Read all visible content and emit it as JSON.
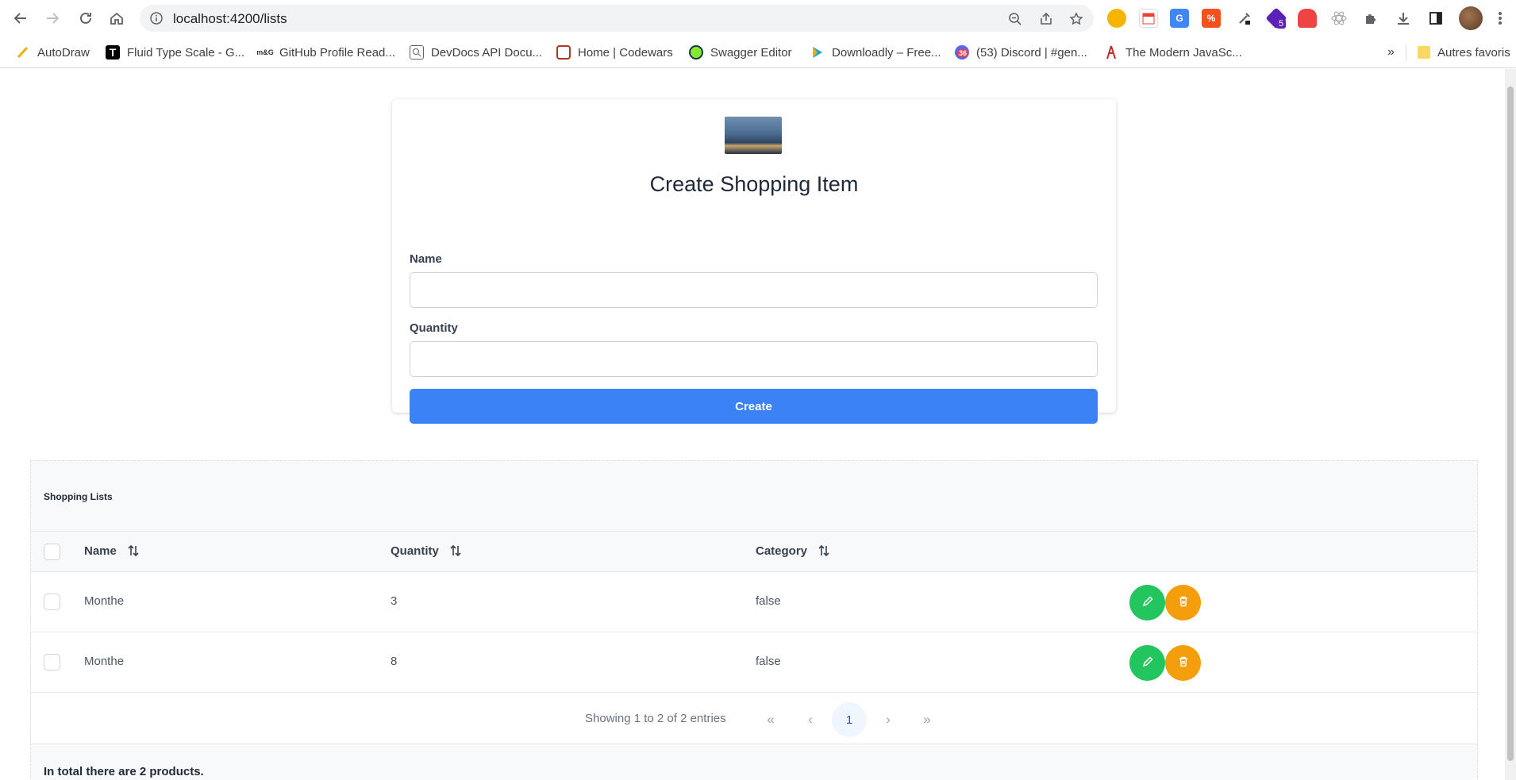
{
  "browser": {
    "url": "localhost:4200/lists",
    "extensions": [
      {
        "name": "chrome-ext-1",
        "color": "#f4b400"
      },
      {
        "name": "calendar-ext",
        "color": "#e8eaed"
      },
      {
        "name": "translate-ext",
        "color": "#4285f4"
      },
      {
        "name": "ext-red",
        "color": "#f4511e"
      },
      {
        "name": "eyedropper-ext",
        "color": "#5f6368"
      },
      {
        "name": "ext-purple",
        "color": "#5b21b6"
      },
      {
        "name": "ext-pig",
        "color": "#ef4444"
      },
      {
        "name": "react-devtools-ext",
        "color": "#9aa0a6"
      },
      {
        "name": "extensions-icon",
        "color": "#5f6368"
      },
      {
        "name": "download-icon",
        "color": "#5f6368"
      }
    ],
    "badge_count": "5",
    "bookmarks": [
      {
        "label": "AutoDraw",
        "icon": "autodraw-icon"
      },
      {
        "label": "Fluid Type Scale - G...",
        "icon": "t-icon"
      },
      {
        "label": "GitHub Profile Read...",
        "icon": "rsg-icon"
      },
      {
        "label": "DevDocs API Docu...",
        "icon": "devdocs-icon"
      },
      {
        "label": "Home | Codewars",
        "icon": "codewars-icon"
      },
      {
        "label": "Swagger Editor",
        "icon": "swagger-icon"
      },
      {
        "label": "Downloadly – Free...",
        "icon": "downloadly-icon"
      },
      {
        "label": "(53) Discord | #gen...",
        "icon": "discord-icon"
      },
      {
        "label": "The Modern JavaSc...",
        "icon": "js-icon"
      }
    ],
    "discord_badge": "36",
    "overflow_label": "»",
    "other_bookmarks": "Autres favoris"
  },
  "form": {
    "title": "Create Shopping Item",
    "name_label": "Name",
    "name_value": "",
    "quantity_label": "Quantity",
    "quantity_value": "",
    "create_label": "Create"
  },
  "table": {
    "title": "Shopping Lists",
    "columns": [
      "Name",
      "Quantity",
      "Category"
    ],
    "rows": [
      {
        "name": "Monthe",
        "quantity": "3",
        "category": "false"
      },
      {
        "name": "Monthe",
        "quantity": "8",
        "category": "false"
      }
    ],
    "paginator": {
      "info": "Showing 1 to 2 of 2 entries",
      "first": "«",
      "prev": "‹",
      "current": "1",
      "next": "›",
      "last": "»"
    },
    "footer": "In total there are 2 products."
  },
  "colors": {
    "primary": "#3b82f6",
    "edit": "#22c55e",
    "delete": "#f59e0b"
  }
}
